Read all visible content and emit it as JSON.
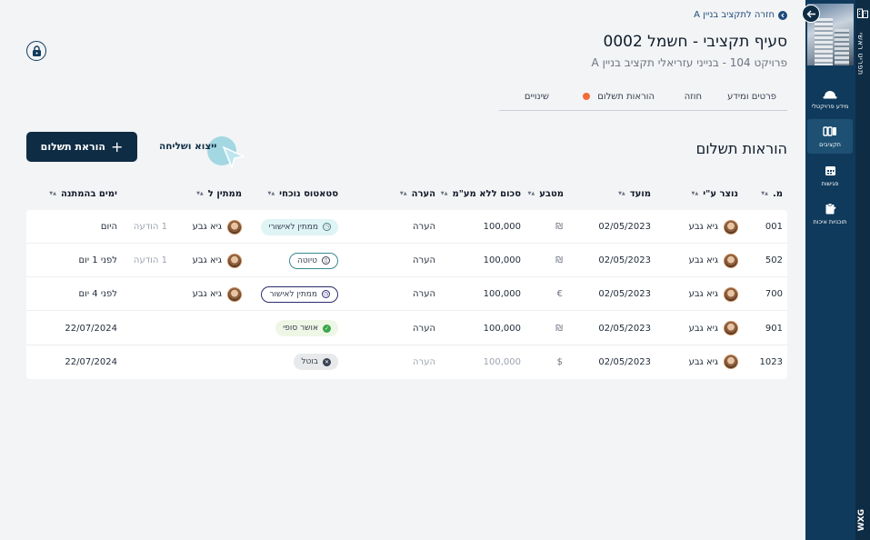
{
  "header": {
    "back_link": "חזרה לתקציב בניין A",
    "title": "סעיף תקציבי -  חשמל 0002",
    "subtitle": "פרויקט 104 - בנייני עזריאלי תקציב בניין A"
  },
  "tabs": [
    {
      "label": "פרטים ומידע"
    },
    {
      "label": "חוזה"
    },
    {
      "label": "הוראות תשלום",
      "active": true
    },
    {
      "label": "שינויים"
    }
  ],
  "section": {
    "title": "הוראות תשלום",
    "add_label": "הוראת תשלום",
    "export_label": "ייצוא ושליחה"
  },
  "sidebar": {
    "rail_title": "תפריט ראשי",
    "brand": "WXG",
    "items": [
      {
        "label": "מידע פרויקטלי",
        "icon": "helmet-icon"
      },
      {
        "label": "תקציבים",
        "icon": "budget-icon",
        "active": true
      },
      {
        "label": "פגישות",
        "icon": "calendar-icon"
      },
      {
        "label": "תוכניות איכות",
        "icon": "clipboard-icon"
      }
    ]
  },
  "table": {
    "columns": [
      "מ.",
      "נוצר ע\"י",
      "מועד",
      "מטבע",
      "סכום ללא מע\"מ",
      "הערה",
      "סטאטוס נוכחי",
      "ממתין ל",
      "ימים בהמתנה"
    ],
    "rows": [
      {
        "id": "001",
        "creator": "גיא גבע",
        "date": "02/05/2023",
        "currency": "₪",
        "amount": "100,000",
        "note": "הערה",
        "status": "ממתין לאישורי",
        "status_kind": "pending-light",
        "waiting_for": "גיא גבע",
        "notice": "1 הודעה",
        "days": "היום"
      },
      {
        "id": "502",
        "creator": "גיא גבע",
        "date": "02/05/2023",
        "currency": "₪",
        "amount": "100,000",
        "note": "הערה",
        "status": "טיוטה",
        "status_kind": "draft",
        "waiting_for": "גיא גבע",
        "notice": "1 הודעה",
        "days": "לפני 1 יום"
      },
      {
        "id": "700",
        "creator": "גיא גבע",
        "date": "02/05/2023",
        "currency": "€",
        "amount": "100,000",
        "note": "הערה",
        "status": "ממתין לאישור",
        "status_kind": "pending",
        "waiting_for": "גיא גבע",
        "notice": "",
        "days": "לפני 4 יום"
      },
      {
        "id": "901",
        "creator": "גיא גבע",
        "date": "02/05/2023",
        "currency": "₪",
        "amount": "100,000",
        "note": "הערה",
        "status": "אושר סופי",
        "status_kind": "approved",
        "waiting_for": "",
        "notice": "",
        "days": "22/07/2024"
      },
      {
        "id": "1023",
        "creator": "גיא גבע",
        "date": "02/05/2023",
        "currency": "$",
        "amount": "100,000",
        "note": "הערה",
        "status": "בוטל",
        "status_kind": "cancelled",
        "waiting_for": "",
        "notice": "",
        "days": "22/07/2024",
        "muted": true
      }
    ]
  },
  "colors": {
    "primary_dark": "#0e2c44",
    "sidebar": "#0f3a5c",
    "accent_orange": "#f26b3a"
  }
}
